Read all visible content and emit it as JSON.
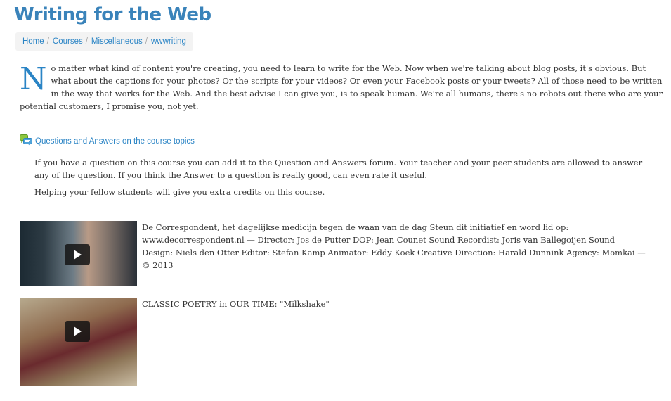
{
  "page": {
    "title": "Writing for the Web"
  },
  "breadcrumb": {
    "items": [
      {
        "label": "Home"
      },
      {
        "label": "Courses"
      },
      {
        "label": "Miscellaneous"
      },
      {
        "label": "wwwriting"
      }
    ],
    "separator": "/"
  },
  "intro": {
    "dropcap": "N",
    "text": "o matter what kind of content you're creating, you need to learn to write for the Web. Now when we're talking about blog posts, it's obvious. But what about the captions for your photos? Or the scripts for your videos? Or even your Facebook posts or your tweets? All of those need to be written in the way that works for the Web. And the best advise I can give you, is to speak human. We're all humans, there's no robots out there who are your potential customers, I promise you, not yet."
  },
  "forum": {
    "icon": "forum-icon",
    "link_label": "Questions and Answers on the course topics",
    "description": [
      "If you have a question on this course you can add it to the Question and Answers forum. Your teacher and your peer students are allowed to answer any of the question. If you think the Answer to a question is really good, can even rate it useful.",
      "Helping your fellow students will give you extra credits on this course."
    ]
  },
  "videos": [
    {
      "icon": "play-icon",
      "description": "De Correspondent, het dagelijkse medicijn tegen de waan van de dag Steun dit initiatief en word lid op: www.decorrespondent.nl — Director: Jos de Putter DOP: Jean Counet Sound Recordist: Joris van Ballegoijen Sound Design: Niels den Otter Editor: Stefan Kamp Animator: Eddy Koek Creative Direction: Harald Dunnink Agency: Momkai — © 2013"
    },
    {
      "icon": "play-icon",
      "description": "CLASSIC POETRY in OUR TIME: \"Milkshake\""
    }
  ],
  "colors": {
    "accent": "#2a84c5",
    "title": "#3a83ba",
    "text": "#333333"
  }
}
